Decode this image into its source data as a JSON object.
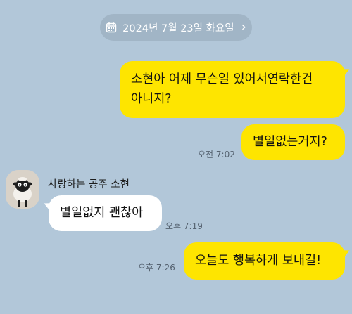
{
  "date_header": {
    "label": "2024년 7월 23일 화요일",
    "chevron": "›",
    "icon": "calendar-icon"
  },
  "messages": [
    {
      "side": "right",
      "text_line1": "소현아 어제 무슨일 있어서연락한건",
      "text_line2": "아니지?"
    },
    {
      "side": "right",
      "text": "별일없는거지?",
      "time": "오전 7:02"
    },
    {
      "side": "left",
      "sender": "사랑하는 공주 소현",
      "text": "별일없지 괜찮아",
      "time": "오후 7:19"
    },
    {
      "side": "right",
      "text": "오늘도 행복하게 보내길!",
      "time": "오후 7:26"
    }
  ],
  "colors": {
    "background": "#b2c7d9",
    "my_bubble": "#fee500",
    "their_bubble": "#ffffff",
    "pill": "#a1b5c6"
  }
}
